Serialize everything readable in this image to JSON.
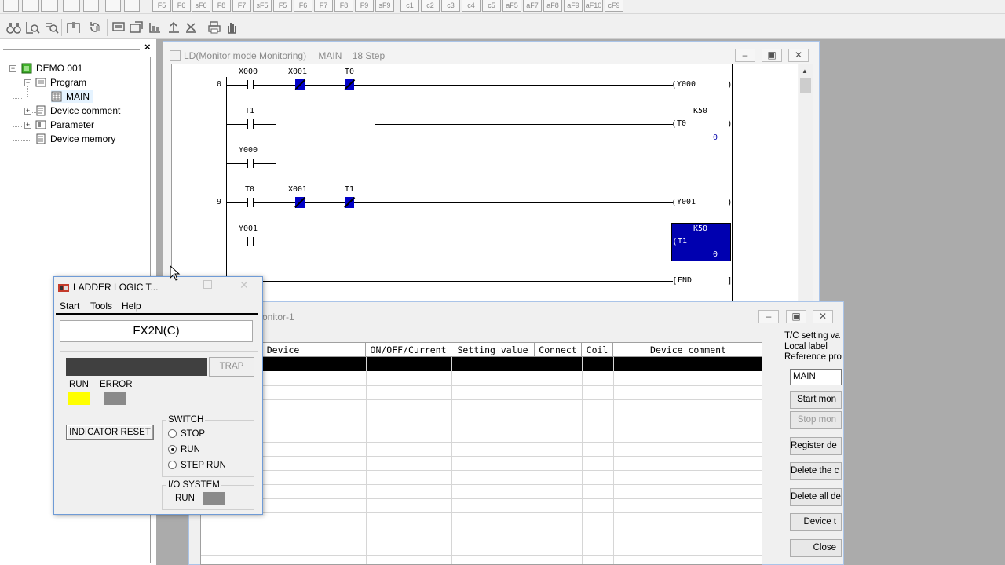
{
  "toolbar1": {
    "buttons": [
      "F5",
      "F6",
      "sF6",
      "F8",
      "F7",
      "sF5",
      "F5",
      "F6",
      "F7",
      "F8",
      "F9",
      "sF9",
      "c1",
      "c2",
      "c3",
      "c4",
      "c5",
      "aF5",
      "aF7",
      "aF8",
      "aF9",
      "aF10",
      "cF9"
    ]
  },
  "tree": {
    "root": "DEMO 001",
    "program": "Program",
    "main": "MAIN",
    "device_comment": "Device comment",
    "parameter": "Parameter",
    "device_memory": "Device memory",
    "close_glyph": "×"
  },
  "ld_window": {
    "title": "LD(Monitor mode Monitoring)",
    "program": "MAIN",
    "steps": "18 Step",
    "rungs": {
      "r1": {
        "step": "0",
        "c1": "X000",
        "c2": "X001",
        "c3": "T0",
        "p1": "T1",
        "p2": "Y000",
        "coil1": "Y000",
        "coil2": "T0",
        "k": "K50",
        "cur": "0"
      },
      "r2": {
        "step": "9",
        "c1": "T0",
        "c2": "X001",
        "c3": "T1",
        "p1": "Y001",
        "coil1": "Y001",
        "coil2": "T1",
        "k": "K50",
        "cur": "0"
      },
      "end": "END"
    }
  },
  "monitor_window": {
    "title": "onitor-1",
    "columns": [
      "Device",
      "ON/OFF/Current",
      "Setting value",
      "Connect",
      "Coil",
      "Device comment"
    ],
    "right_labels": [
      "T/C setting va",
      "Local label",
      "Reference pro"
    ],
    "program_value": "MAIN",
    "buttons": [
      "Start mon",
      "Stop mon",
      "Register de",
      "Delete the c",
      "Delete all de",
      "Device t",
      "Close"
    ]
  },
  "llt": {
    "title": "LADDER LOGIC T...",
    "menu": [
      "Start",
      "Tools",
      "Help"
    ],
    "model": "FX2N(C)",
    "trap": "TRAP",
    "run_label": "RUN",
    "error_label": "ERROR",
    "indicator_reset": "INDICATOR RESET",
    "switch_label": "SWITCH",
    "switch_options": [
      "STOP",
      "RUN",
      "STEP RUN"
    ],
    "switch_selected": "RUN",
    "io_label": "I/O SYSTEM",
    "io_run": "RUN",
    "colors": {
      "run_lamp": "#ffff00",
      "error_lamp": "#8a8a8a",
      "io_lamp": "#8a8a8a",
      "trap_bar": "#404040"
    }
  },
  "colors": {
    "selection_blue": "#0000b0",
    "contact_blue": "#0000c8",
    "mdi_gray": "#ababab"
  }
}
